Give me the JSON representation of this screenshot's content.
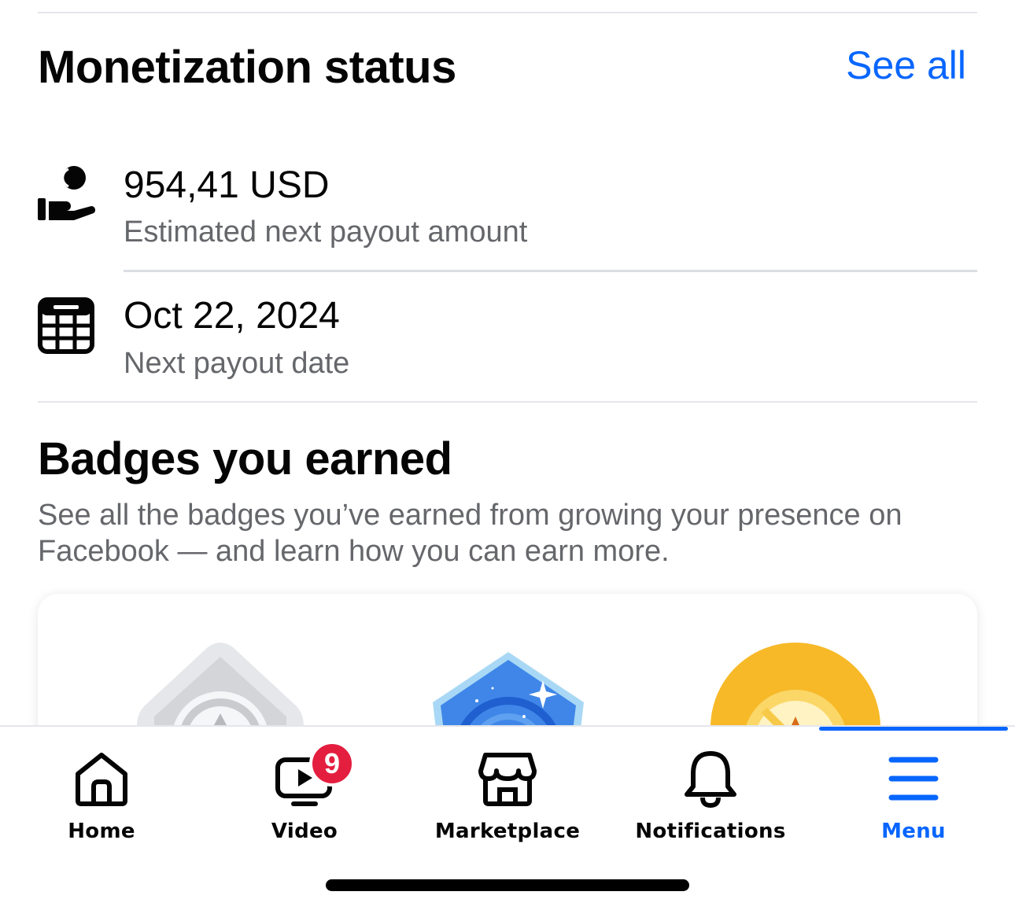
{
  "monetization": {
    "title": "Monetization status",
    "see_all": "See all",
    "payout": {
      "amount": "954,41 USD",
      "label": "Estimated next payout amount",
      "icon": "hand-coin-icon"
    },
    "date": {
      "value": "Oct 22, 2024",
      "label": "Next payout date",
      "icon": "calendar-icon"
    }
  },
  "badges": {
    "title": "Badges you earned",
    "description": "See all the badges you’ve earned from growing your presence on Facebook — and learn how you can earn more.",
    "items": [
      {
        "icon": "silver-badge-icon"
      },
      {
        "icon": "blue-galaxy-badge-icon"
      },
      {
        "icon": "gold-star-coin-badge-icon"
      }
    ]
  },
  "nav": {
    "items": [
      {
        "label": "Home",
        "icon": "home-icon"
      },
      {
        "label": "Video",
        "icon": "video-icon",
        "badge": "9"
      },
      {
        "label": "Marketplace",
        "icon": "marketplace-icon"
      },
      {
        "label": "Notifications",
        "icon": "bell-icon"
      },
      {
        "label": "Menu",
        "icon": "menu-icon",
        "active": true
      }
    ]
  },
  "colors": {
    "accent": "#0866ff",
    "text_primary": "#050505",
    "text_secondary": "#65676b",
    "badge_red": "#e41e3f"
  }
}
